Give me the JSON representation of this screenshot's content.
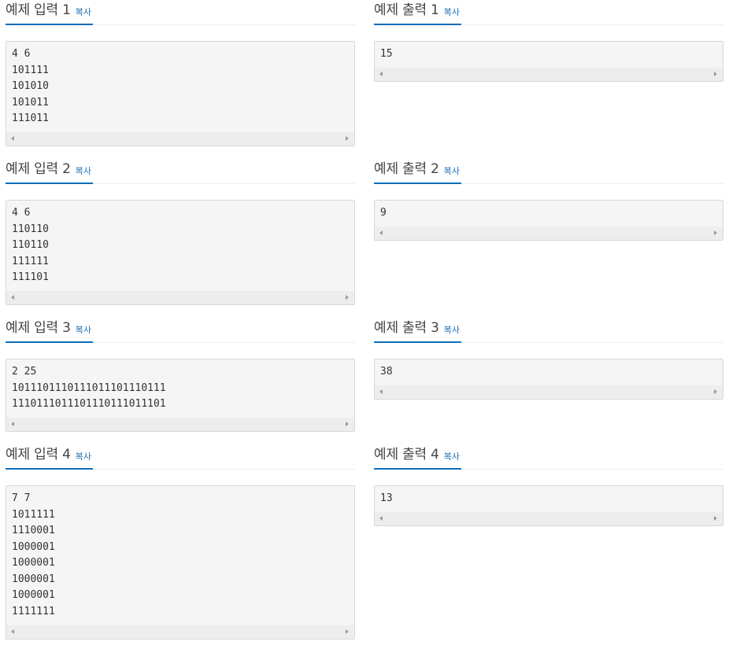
{
  "copy_label": "복사",
  "examples": [
    {
      "input_title": "예제 입력 1",
      "input_lines": "4 6\n101111\n101010\n101011\n111011",
      "output_title": "예제 출력 1",
      "output_lines": "15"
    },
    {
      "input_title": "예제 입력 2",
      "input_lines": "4 6\n110110\n110110\n111111\n111101",
      "output_title": "예제 출력 2",
      "output_lines": "9"
    },
    {
      "input_title": "예제 입력 3",
      "input_lines": "2 25\n1011101110111011101110111\n1110111011101110111011101",
      "output_title": "예제 출력 3",
      "output_lines": "38"
    },
    {
      "input_title": "예제 입력 4",
      "input_lines": "7 7\n1011111\n1110001\n1000001\n1000001\n1000001\n1000001\n1111111",
      "output_title": "예제 출력 4",
      "output_lines": "13"
    }
  ]
}
